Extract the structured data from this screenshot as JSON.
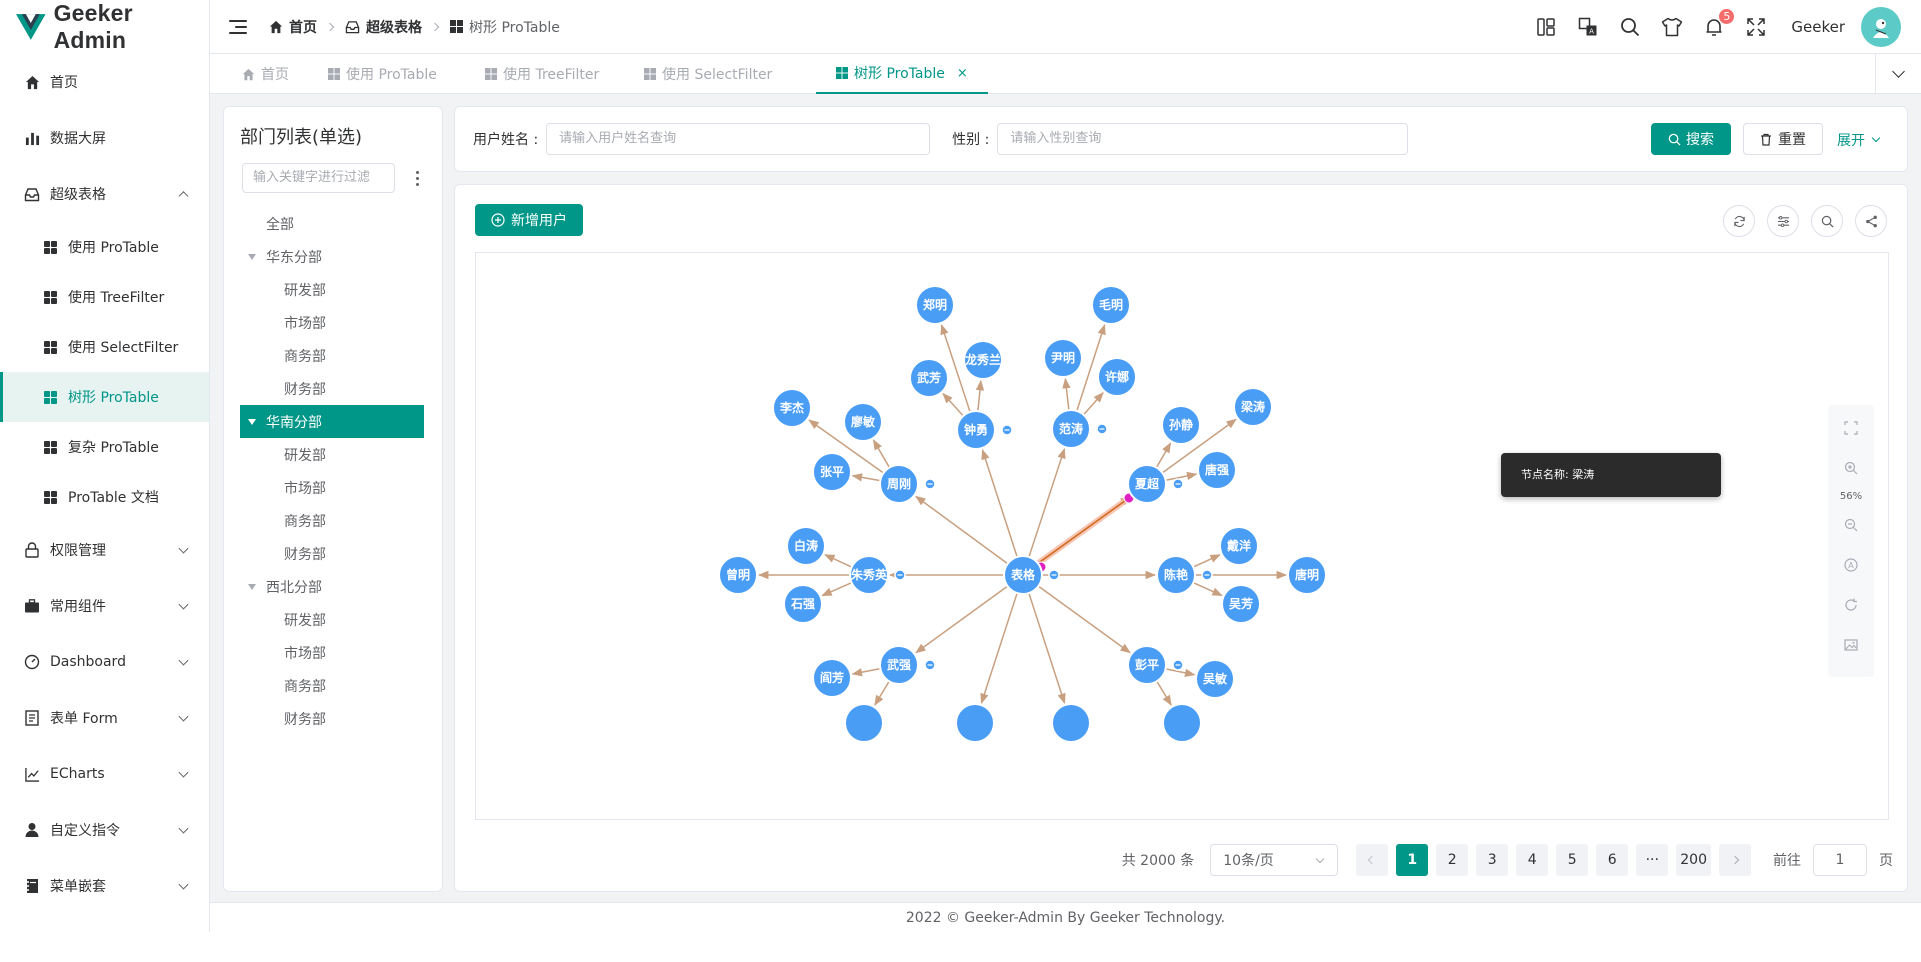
{
  "app": {
    "title": "Geeker Admin",
    "brand_color": "#009688"
  },
  "sidebar": {
    "items": [
      {
        "label": "首页",
        "icon": "home-icon"
      },
      {
        "label": "数据大屏",
        "icon": "bar-chart-icon"
      },
      {
        "label": "超级表格",
        "icon": "inbox-icon",
        "expanded": true
      },
      {
        "label": "权限管理",
        "icon": "lock-icon"
      },
      {
        "label": "常用组件",
        "icon": "briefcase-icon"
      },
      {
        "label": "Dashboard",
        "icon": "odometer-icon"
      },
      {
        "label": "表单 Form",
        "icon": "document-icon"
      },
      {
        "label": "ECharts",
        "icon": "trend-chart-icon"
      },
      {
        "label": "自定义指令",
        "icon": "user-icon"
      },
      {
        "label": "菜单嵌套",
        "icon": "notebook-icon"
      }
    ],
    "sub_items": [
      {
        "label": "使用 ProTable"
      },
      {
        "label": "使用 TreeFilter"
      },
      {
        "label": "使用 SelectFilter"
      },
      {
        "label": "树形 ProTable",
        "active": true
      },
      {
        "label": "复杂 ProTable"
      },
      {
        "label": "ProTable 文档"
      }
    ]
  },
  "header": {
    "breadcrumb": [
      "首页",
      "超级表格",
      "树形 ProTable"
    ],
    "username": "Geeker",
    "notification_count": "5"
  },
  "tabs": [
    {
      "label": "首页"
    },
    {
      "label": "使用 ProTable"
    },
    {
      "label": "使用 TreeFilter"
    },
    {
      "label": "使用 SelectFilter"
    },
    {
      "label": "树形 ProTable",
      "active": true,
      "close": "×"
    }
  ],
  "tree_panel": {
    "title": "部门列表(单选)",
    "filter_placeholder": "输入关键字进行过滤",
    "nodes": [
      {
        "label": "全部",
        "level": 0
      },
      {
        "label": "华东分部",
        "level": 1,
        "expanded": true
      },
      {
        "label": "研发部",
        "level": 2
      },
      {
        "label": "市场部",
        "level": 2
      },
      {
        "label": "商务部",
        "level": 2
      },
      {
        "label": "财务部",
        "level": 2
      },
      {
        "label": "华南分部",
        "level": 1,
        "expanded": true,
        "selected": true
      },
      {
        "label": "研发部",
        "level": 2
      },
      {
        "label": "市场部",
        "level": 2
      },
      {
        "label": "商务部",
        "level": 2
      },
      {
        "label": "财务部",
        "level": 2
      },
      {
        "label": "西北分部",
        "level": 1,
        "expanded": true
      },
      {
        "label": "研发部",
        "level": 2
      },
      {
        "label": "市场部",
        "level": 2
      },
      {
        "label": "商务部",
        "level": 2
      },
      {
        "label": "财务部",
        "level": 2
      }
    ]
  },
  "search_form": {
    "username_label": "用户姓名 :",
    "username_placeholder": "请输入用户姓名查询",
    "gender_label": "性别 :",
    "gender_placeholder": "请输入性别查询",
    "search_button": "搜索",
    "reset_button": "重置",
    "expand_link": "展开"
  },
  "table": {
    "add_button": "新增用户",
    "tools": [
      "refresh-icon",
      "column-settings-icon",
      "search-icon",
      "share-icon"
    ]
  },
  "graph": {
    "tooltip": "节点名称: 梁涛",
    "zoom": "56%",
    "node_color": "#4a9df5",
    "edge_color": "#c8a080",
    "highlight_color": "#e020c0",
    "nodes": [
      {
        "id": "root",
        "label": "表格",
        "collapse": true
      },
      {
        "id": "n1",
        "label": "郑明"
      },
      {
        "id": "n2",
        "label": "毛明"
      },
      {
        "id": "n3",
        "label": "龙秀兰"
      },
      {
        "id": "n4",
        "label": "尹明"
      },
      {
        "id": "n5",
        "label": "武芳"
      },
      {
        "id": "n6",
        "label": "许娜"
      },
      {
        "id": "n7",
        "label": "李杰"
      },
      {
        "id": "n8",
        "label": "廖敏"
      },
      {
        "id": "n9",
        "label": "钟勇",
        "collapse": true
      },
      {
        "id": "n10",
        "label": "范涛",
        "collapse": true
      },
      {
        "id": "n11",
        "label": "孙静"
      },
      {
        "id": "n12",
        "label": "梁涛"
      },
      {
        "id": "n13",
        "label": "张平"
      },
      {
        "id": "n14",
        "label": "周刚",
        "collapse": true
      },
      {
        "id": "n15",
        "label": "夏超",
        "collapse": true
      },
      {
        "id": "n16",
        "label": "唐强"
      },
      {
        "id": "n17",
        "label": "白涛"
      },
      {
        "id": "n18",
        "label": "戴洋"
      },
      {
        "id": "n19",
        "label": "曾明"
      },
      {
        "id": "n20",
        "label": "朱秀英",
        "collapse": true
      },
      {
        "id": "n21",
        "label": "陈艳",
        "collapse": true
      },
      {
        "id": "n22",
        "label": "唐明"
      },
      {
        "id": "n23",
        "label": "石强"
      },
      {
        "id": "n24",
        "label": "吴芳"
      },
      {
        "id": "n25",
        "label": "武强",
        "collapse": true
      },
      {
        "id": "n26",
        "label": "彭平",
        "collapse": true
      },
      {
        "id": "n27",
        "label": "阎芳"
      },
      {
        "id": "n28",
        "label": "吴敏"
      },
      {
        "id": "n29",
        "label": ""
      },
      {
        "id": "n30",
        "label": ""
      },
      {
        "id": "n31",
        "label": ""
      },
      {
        "id": "n32",
        "label": ""
      }
    ]
  },
  "pagination": {
    "total": "共 2000 条",
    "page_size": "10条/页",
    "pages": [
      "1",
      "2",
      "3",
      "4",
      "5",
      "6",
      "···",
      "200"
    ],
    "current": "1",
    "goto_label": "前往",
    "goto_value": "1",
    "page_suffix": "页"
  },
  "footer": {
    "text": "2022 © Geeker-Admin By Geeker Technology."
  }
}
